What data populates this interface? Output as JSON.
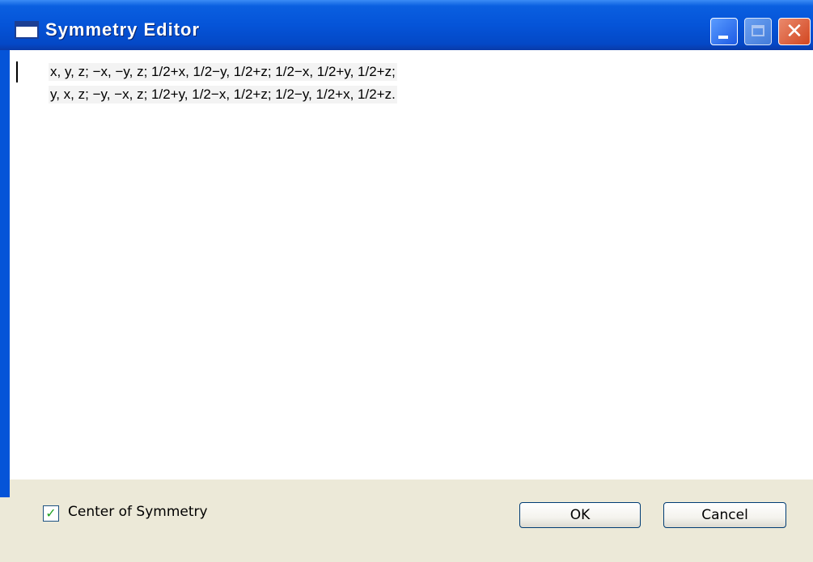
{
  "window": {
    "title": "Symmetry Editor"
  },
  "titlebar": {
    "minimize_icon": "minimize-icon",
    "maximize_icon": "maximize-icon",
    "close_icon": "close-icon",
    "close_glyph": "✕"
  },
  "editor": {
    "lines": [
      "x, y, z; −x, −y, z; 1/2+x, 1/2−y, 1/2+z; 1/2−x, 1/2+y, 1/2+z;",
      "y, x, z; −y, −x, z; 1/2+y, 1/2−x, 1/2+z; 1/2−y, 1/2+x, 1/2+z."
    ]
  },
  "options": {
    "center_of_symmetry_label": "Center of Symmetry",
    "center_of_symmetry_checked": true,
    "check_glyph": "✓"
  },
  "buttons": {
    "ok_label": "OK",
    "cancel_label": "Cancel"
  }
}
